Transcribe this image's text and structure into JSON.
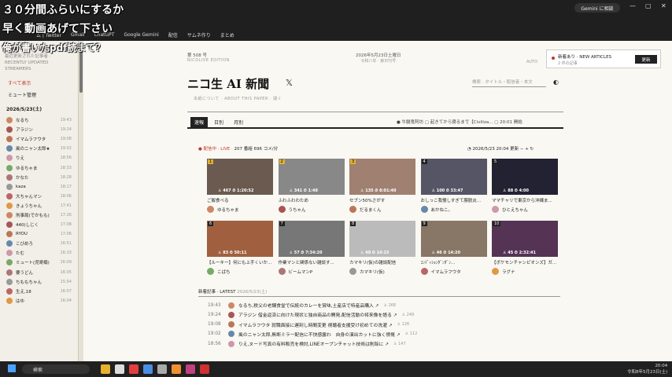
{
  "overlay": {
    "line1": "３０分間ふらいにするか",
    "line2": "早く動画あげて下さい",
    "line3": "俺が書いたpdf読まて？"
  },
  "browser": {
    "gemini": "Gemini に相談",
    "win": [
      "—",
      "▢",
      "✕"
    ],
    "bookmarks": [
      "ム | Twitter",
      "Gmail",
      "ChatGPT",
      "Google Gemini",
      "配信",
      "サムネ作り",
      "まとめ"
    ]
  },
  "sidebar": {
    "head": "最近更新された記事者 · RECENTLY UPDATED STREAMERS",
    "nav": [
      "すべて表示",
      "ミュート管理"
    ],
    "date": "2026/5/23(土)",
    "rows": [
      {
        "n": "なるち",
        "t": "19:43"
      },
      {
        "n": "アラジン",
        "t": "19:24"
      },
      {
        "n": "イマムラフウタ",
        "t": "19:08"
      },
      {
        "n": "風のニャン太郎★",
        "t": "19:02"
      },
      {
        "n": "りえ",
        "t": "18:56"
      },
      {
        "n": "ゆるちゃま",
        "t": "18:33"
      },
      {
        "n": "かなた",
        "t": "18:28"
      },
      {
        "n": "kaza",
        "t": "18:17"
      },
      {
        "n": "大ちゃんマン",
        "t": "18:06"
      },
      {
        "n": "きょうちゃん",
        "t": "17:41"
      },
      {
        "n": "刑事局(でかもも)",
        "t": "17:26"
      },
      {
        "n": "440(しじく",
        "t": "17:08"
      },
      {
        "n": "RYOU",
        "t": "17:06"
      },
      {
        "n": "こびめろ",
        "t": "16:51"
      },
      {
        "n": "たむ",
        "t": "16:33"
      },
      {
        "n": "ミュート(児哥楠)",
        "t": "16:09"
      },
      {
        "n": "要うどん",
        "t": "16:05"
      },
      {
        "n": "ちももちゃん",
        "t": "15:54"
      },
      {
        "n": "生え,18",
        "t": "16:07"
      },
      {
        "n": "はゆ",
        "t": "16:04"
      }
    ]
  },
  "header": {
    "issue": "第 508 号",
    "edition": "NICOLIVE EDITION",
    "date": "2026年5月23日土曜日",
    "era": "令和八年 · 第日刊号",
    "auto": "AUTO",
    "title": "ニコ生 AI 新聞",
    "x": "𝕏",
    "search": "検索 · タイトル・配信者・本文",
    "moon": "◐",
    "about": "本紙について · ABOUT THIS PAPER · 開く",
    "notice_t1": "新着あり · NEW ARTICLES",
    "notice_t2": "2 件の記事",
    "notice_btn": "更新"
  },
  "tabs": [
    "速報",
    "日別",
    "月別"
  ],
  "ticker": "● 牛腸鬼阿坊  ▢ 起きてから寝るまで【Civiliza...  ▢ 20:01 開始",
  "live": {
    "label": "● 配信中 · LIVE · ",
    "sub": "207 番組  696 コメ/分",
    "updated": "◔ 2026/5/23 20:04 更新   −  +  ↻"
  },
  "cards": [
    {
      "rk": "1",
      "st": "♙ 467 ⏱ 1:20:52",
      "ti": "ご飯食べる",
      "au": "ゆるちゃま"
    },
    {
      "rk": "2",
      "st": "♙ 341 ⏱ 1:48",
      "ti": "ふわふわわため",
      "au": "うちゃん"
    },
    {
      "rk": "3",
      "st": "♙ 135 ⏱ 8:01:40",
      "ti": "セブン50%さがす",
      "au": "だるまくん"
    },
    {
      "rk": "4",
      "st": "♙ 100 ⏱ 33:47",
      "ti": "おしっこ我慢しすぎて膀胱炎...",
      "au": "あかねこ。"
    },
    {
      "rk": "5",
      "st": "♙ 88 ⏱ 4:00",
      "ti": "ママチャリで東京から沖縄ま...",
      "au": "ひとえちゃん"
    },
    {
      "rk": "6",
      "st": "♙ 83 ⏱ 50:11",
      "ti": "【ルーキー】何にも上手くいか...",
      "au": "こばち"
    },
    {
      "rk": "7",
      "st": "♙ 57 ⏱ 7:34:20",
      "ti": "作業マンと関係ない雑談す...",
      "au": "ビームマンP"
    },
    {
      "rk": "8",
      "st": "♙ 48 ⏱ 14:15",
      "ti": "カマキリ(仮)の雑談配信",
      "au": "カマキリ(仮)"
    },
    {
      "rk": "9",
      "st": "♙ 46 ⏱ 14:20",
      "ti": "ｺﾝﾃﾞｨｼｮﾝﾀﾞﾝﾀﾞﾝ...",
      "au": "イマムラフウタ"
    },
    {
      "rk": "10",
      "st": "♙ 45 ⏱ 2:32:41",
      "ti": "【ポケモンチャンピオンズ】ガ...",
      "au": "ラグナ"
    }
  ],
  "news": {
    "label": "新着記事 · LATEST",
    "date": "2026/5/23(土)",
    "rows": [
      {
        "t": "19:43",
        "s": "なるち,秩父の老舗食堂で伝統のカレーを賞味,土産店で特産品購入 ↗",
        "c": "♙ 268"
      },
      {
        "t": "19:24",
        "s": "アラジン 借金返済に向けた現状と独自商品の開発,配信活動の将来像を語る ↗",
        "c": "♙ 249"
      },
      {
        "t": "19:08",
        "s": "イマムラフウタ 就職面接に遅刻し時間変更 視聴者支援受け初めての洗濯 ↗",
        "c": "♙ 126"
      },
      {
        "t": "19:02",
        "s": "風のニャン太郎,無断ミラー配信に不快感露わ　自身の演出カットに強く憤慨 ↗",
        "c": "♙ 112"
      },
      {
        "t": "18:56",
        "s": "りえ,ヌード写真の有料販売を検討,LINEオープンチャット技術は削除に ↗",
        "c": "♙ 147"
      }
    ]
  },
  "taskbar": {
    "search": "検索",
    "time": "20:04",
    "date": "令和8年5月23日(土)"
  }
}
